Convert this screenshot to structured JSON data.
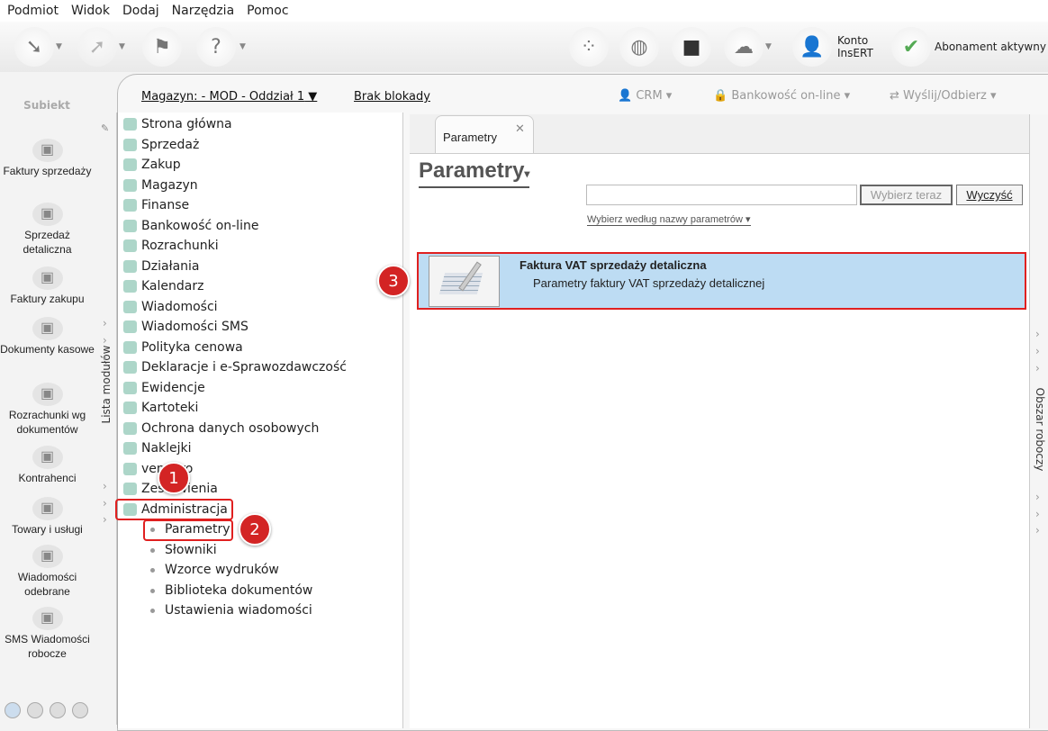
{
  "menu": [
    "Podmiot",
    "Widok",
    "Dodaj",
    "Narzędzia",
    "Pomoc"
  ],
  "toolbar": {
    "account_line1": "Konto",
    "account_line2": "InsERT",
    "subscription": "Abonament aktywny",
    "logo_text": "Subiekt"
  },
  "subbar": {
    "warehouse": "Magazyn: - MOD - Oddział 1",
    "lock": "Brak blokady",
    "crm": "CRM",
    "banking": "Bankowość on-line",
    "send": "Wyślij/Odbierz"
  },
  "sidebar": [
    {
      "label": "Faktury sprzedaży",
      "icon": "invoices-icon"
    },
    {
      "label": "Sprzedaż detaliczna",
      "icon": "retail-basket-icon"
    },
    {
      "label": "Faktury zakupu",
      "icon": "purchase-invoices-icon"
    },
    {
      "label": "Dokumenty kasowe",
      "icon": "cash-documents-icon"
    },
    {
      "label": "Rozrachunki wg dokumentów",
      "icon": "settlements-icon"
    },
    {
      "label": "Kontrahenci",
      "icon": "contractor-icon"
    },
    {
      "label": "Towary i usługi",
      "icon": "goods-icon"
    },
    {
      "label": "Wiadomości odebrane",
      "icon": "inbox-icon"
    },
    {
      "label": "SMS Wiadomości robocze",
      "icon": "sms-icon"
    }
  ],
  "module_list_label": "Lista modułów",
  "modules": [
    "Strona główna",
    "Sprzedaż",
    "Zakup",
    "Magazyn",
    "Finanse",
    "Bankowość on-line",
    "Rozrachunki",
    "Działania",
    "Kalendarz",
    "Wiadomości",
    "Wiadomości SMS",
    "Polityka cenowa",
    "Deklaracje i e-Sprawozdawczość",
    "Ewidencje",
    "Kartoteki",
    "Ochrona danych osobowych",
    "Naklejki",
    "vendero",
    "Zestawienia",
    "Administracja"
  ],
  "submodules": [
    "Parametry",
    "Słowniki",
    "Wzorce wydruków",
    "Biblioteka dokumentów",
    "Ustawienia wiadomości"
  ],
  "badges": [
    "1",
    "2",
    "3"
  ],
  "main": {
    "tab": "Parametry",
    "title": "Parametry",
    "search_value": "",
    "choose_btn": "Wybierz teraz",
    "clear_btn": "Wyczyść",
    "filter": "Wybierz według nazwy parametrów",
    "results": [
      {
        "title": "Faktura VAT sprzedaży detaliczna",
        "desc": "Parametry faktury VAT sprzedaży detalicznej"
      }
    ]
  },
  "workspace_label": "Obszar roboczy",
  "colors": {
    "highlight": "#e02020",
    "selected_row": "#bddcf3",
    "badge": "#d32424"
  }
}
